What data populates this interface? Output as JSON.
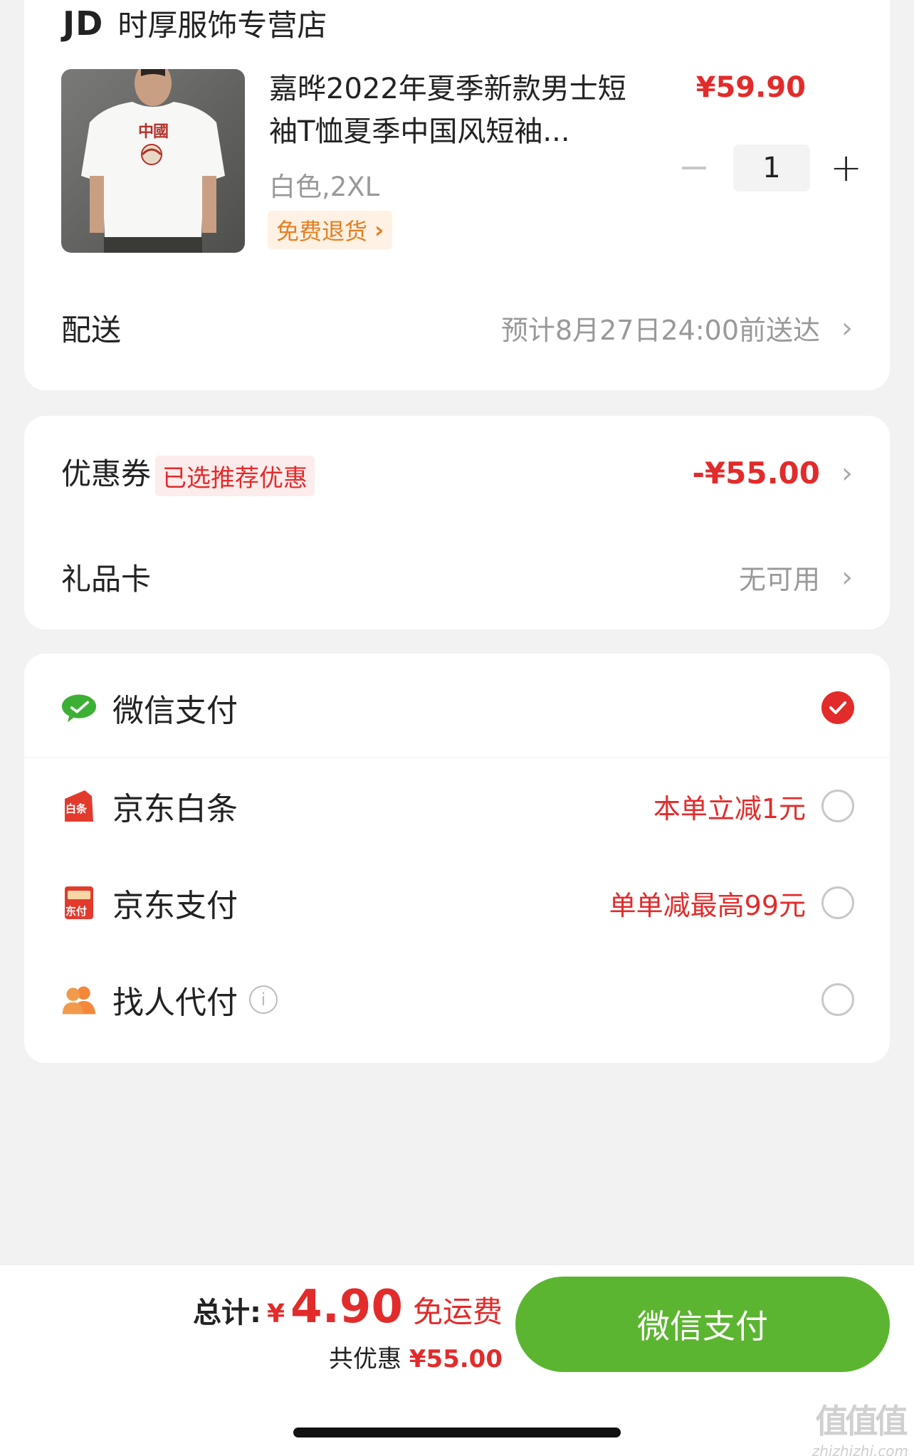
{
  "store": {
    "logo": "JD",
    "name": "时厚服饰专营店"
  },
  "product": {
    "title": "嘉晔2022年夏季新款男士短袖T恤夏季中国风短袖...",
    "spec": "白色,2XL",
    "return_tag": "免费退货",
    "price": "¥59.90",
    "quantity": "1",
    "image_text": "中國"
  },
  "delivery": {
    "label": "配送",
    "value": "预计8月27日24:00前送达"
  },
  "coupon": {
    "label": "优惠券",
    "badge": "已选推荐优惠",
    "value": "-¥55.00"
  },
  "gift_card": {
    "label": "礼品卡",
    "value": "无可用"
  },
  "payment_methods": [
    {
      "label": "微信支付",
      "promo": "",
      "selected": true,
      "icon": "wechat-pay-icon"
    },
    {
      "label": "京东白条",
      "promo": "本单立减1元",
      "selected": false,
      "icon": "jd-baitiao-icon",
      "icon_text": "白条"
    },
    {
      "label": "京东支付",
      "promo": "单单减最高99元",
      "selected": false,
      "icon": "jd-pay-icon",
      "icon_text": "东付"
    },
    {
      "label": "找人代付",
      "promo": "",
      "selected": false,
      "icon": "friend-pay-icon"
    }
  ],
  "summary": {
    "total_label": "总计:",
    "currency": "¥",
    "total_amount": "4.90",
    "free_shipping": "免运费",
    "saved_label": "共优惠",
    "saved_amount": "¥55.00",
    "pay_button": "微信支付"
  },
  "watermark": {
    "logo": "值值值",
    "url": "zhizhizhi.com"
  },
  "colors": {
    "accent_red": "#e22b2b",
    "wechat_green": "#5cb531",
    "orange": "#e67e22"
  }
}
